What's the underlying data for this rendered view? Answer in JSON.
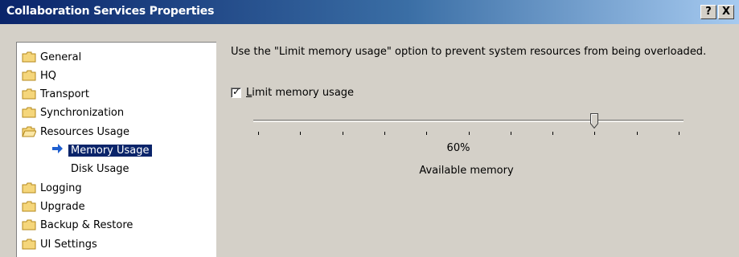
{
  "window": {
    "title": "Collaboration Services Properties",
    "help_label": "?",
    "close_label": "X"
  },
  "tree": {
    "items": [
      {
        "label": "General",
        "icon": "folder-icon"
      },
      {
        "label": "HQ",
        "icon": "folder-icon"
      },
      {
        "label": "Transport",
        "icon": "folder-icon"
      },
      {
        "label": "Synchronization",
        "icon": "folder-icon"
      },
      {
        "label": "Resources Usage",
        "icon": "open-folder-icon"
      },
      {
        "label": "Memory Usage",
        "icon": "arrow-icon",
        "selected": true
      },
      {
        "label": "Disk Usage",
        "icon": "none"
      },
      {
        "label": "Logging",
        "icon": "folder-icon"
      },
      {
        "label": "Upgrade",
        "icon": "folder-icon"
      },
      {
        "label": "Backup & Restore",
        "icon": "folder-icon"
      },
      {
        "label": "UI Settings",
        "icon": "folder-icon"
      }
    ]
  },
  "content": {
    "description": "Use the \"Limit memory usage\" option to prevent system resources from being overloaded.",
    "checkbox_accel": "L",
    "checkbox_rest": "imit memory usage",
    "checkbox_checked": true,
    "slider_value_text": "60%",
    "slider_percent": 0.8,
    "slider_caption": "Available memory"
  },
  "colors": {
    "titlebar_start": "#0a246a",
    "titlebar_end": "#a6caf0",
    "dialog_bg": "#d4d0c8",
    "selection": "#0a246a",
    "arrow": "#1f5fd0"
  }
}
